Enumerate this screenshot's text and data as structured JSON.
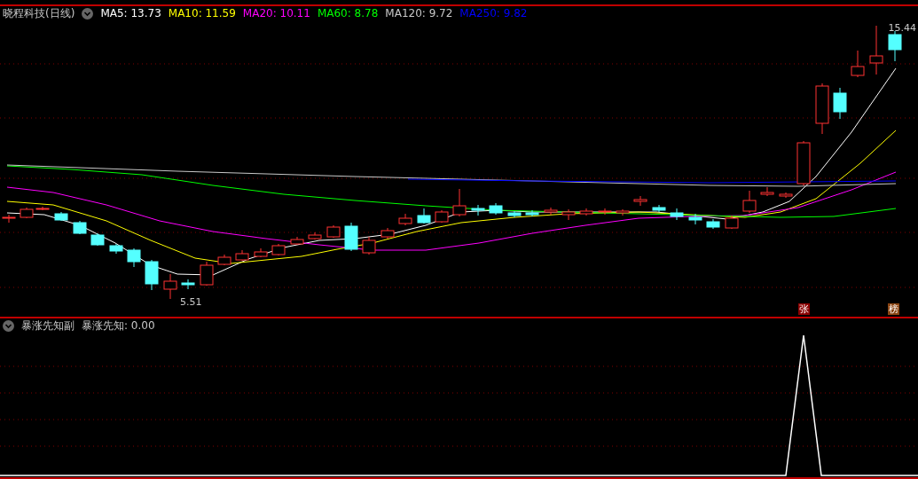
{
  "title": {
    "name": "晓程科技(日线)"
  },
  "ma": [
    {
      "label": "MA5: 13.73",
      "color": "#ffffff"
    },
    {
      "label": "MA10: 11.59",
      "color": "#ffff00"
    },
    {
      "label": "MA20: 10.11",
      "color": "#ff00ff"
    },
    {
      "label": "MA60: 8.78",
      "color": "#00ff00"
    },
    {
      "label": "MA120: 9.72",
      "color": "#c8c8c8"
    },
    {
      "label": "MA250: 9.82",
      "color": "#0000ff"
    }
  ],
  "main_chart": {
    "low_label": "5.51",
    "high_label": "15.44",
    "badges": [
      {
        "text": "张",
        "color": "#8b0000"
      },
      {
        "text": "榜",
        "color": "#8b4513"
      }
    ]
  },
  "sub": {
    "name": "暴涨先知副",
    "value": "暴涨先知: 0.00"
  }
}
